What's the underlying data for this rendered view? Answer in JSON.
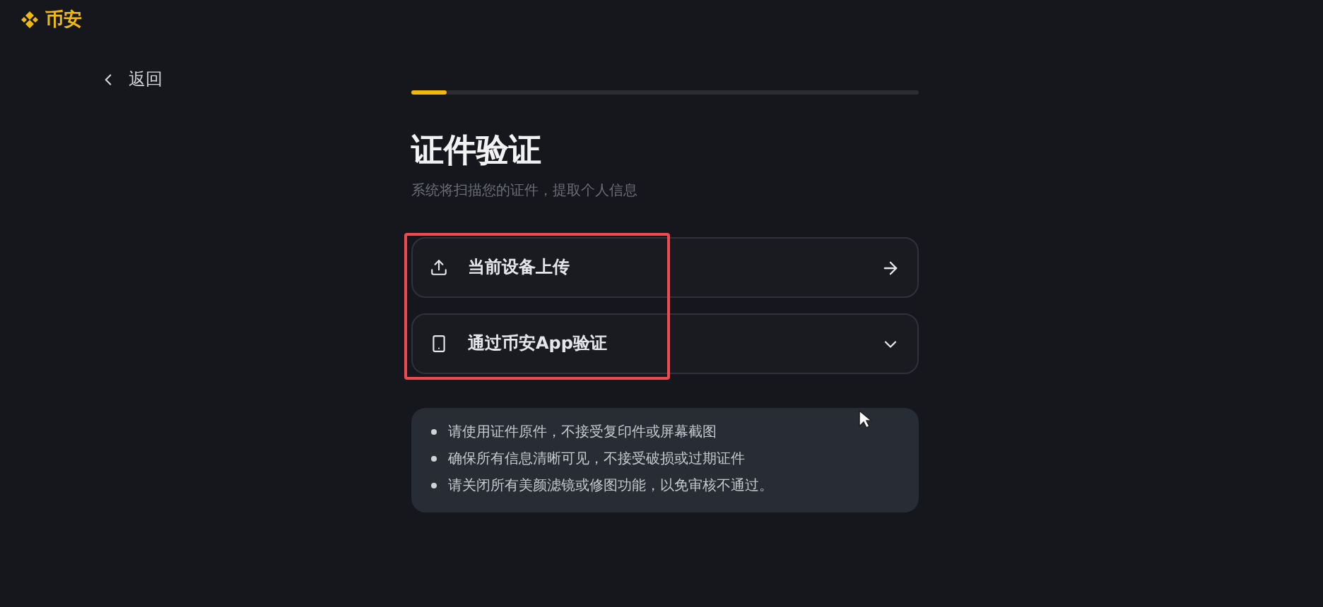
{
  "header": {
    "brand": "币安"
  },
  "back_link": {
    "label": "返回"
  },
  "progress": {
    "level": 0.07
  },
  "title": "证件验证",
  "subtitle": "系统将扫描您的证件，提取个人信息",
  "options": [
    {
      "kind": "upload",
      "label": "当前设备上传",
      "expandable": false
    },
    {
      "kind": "phone",
      "label": "通过币安App验证",
      "expandable": true
    }
  ],
  "tips": [
    "请使用证件原件，不接受复印件或屏幕截图",
    "确保所有信息清晰可见，不接受破损或过期证件",
    "请关闭所有美颜滤镜或修图功能，以免审核不通过。"
  ]
}
